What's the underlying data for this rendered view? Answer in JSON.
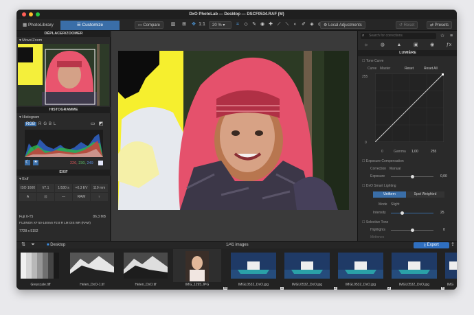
{
  "window": {
    "title": "DxO PhotoLab — Desktop — DSCF0534.RAF (M)"
  },
  "toolbar": {
    "tab_library": "PhotoLibrary",
    "tab_customize": "Customize",
    "compare": "Compare",
    "ratio": "1:1",
    "zoom": "20 %",
    "local_adjustments": "Local Adjustments",
    "reset": "Reset",
    "presets": "Presets"
  },
  "left": {
    "move_zoom_header": "DÉPLACER/ZOOMER",
    "move_zoom_sub": "Move/Zoom",
    "histogram_header": "HISTOGRAMME",
    "histogram_sub": "Histogram",
    "channels": [
      "RGB",
      "R",
      "G",
      "B",
      "L"
    ],
    "rgb_r": "226,",
    "rgb_g": "230,",
    "rgb_b": "249",
    "exif_header": "EXIF",
    "exif_sub": "Exif",
    "exif_row1": [
      "ISO 1600",
      "f/7.1",
      "1/180 s",
      "+0.3 EV",
      "119 mm"
    ],
    "exif_row2": [
      "A",
      "",
      "—",
      "RAW",
      ""
    ],
    "camera": "Fuji X-T5",
    "size": "86,3 MB",
    "lens": "FUJINON XF 50-140mm F2.8 R LM OIS WR (RAW)",
    "dims": "7728 x 5152"
  },
  "right": {
    "search_placeholder": "Search for corrections",
    "header": "LUMIÈRE",
    "tone_curve": "Tone Curve",
    "curve_label": "Curve",
    "curve_channel": "Master",
    "curve_reset": "Reset",
    "curve_reset_all": "Reset All",
    "curve_top_left": "255",
    "curve_bottom_left": "0",
    "curve_bottom_0": "0",
    "gamma_label": "Gamma",
    "gamma": "1,00",
    "curve_max": "255",
    "exposure_comp": "Exposure Compensation",
    "correction_label": "Correction",
    "correction_value": "Manual",
    "exposure_label": "Exposure",
    "exposure_value": "0,00",
    "smart_lighting": "DxO Smart Lighting",
    "mode_uniform": "Uniform",
    "mode_spot": "Spot Weighted",
    "mode_label": "Mode",
    "mode_value": "Slight",
    "intensity_label": "Intensity",
    "intensity_value": "25",
    "selective_tone": "Selective Tone",
    "highlights_label": "Highlights",
    "highlights_value": "0",
    "midtones_label": "Midtones"
  },
  "browser": {
    "folder": "Desktop",
    "count": "1/41 images",
    "export": "Export",
    "items": [
      {
        "name": "Greyscale.tiff",
        "badge": ""
      },
      {
        "name": "Helen_DxO-1.tif",
        "badge": ""
      },
      {
        "name": "Helen_DxO.tif",
        "badge": ""
      },
      {
        "name": "IMG_1295.JPG",
        "badge": "M"
      },
      {
        "name": "IMGL0532_DxO.jpg",
        "badge": "1"
      },
      {
        "name": "IMGL0532_DxO.jpg",
        "badge": "2"
      },
      {
        "name": "IMGL0532_DxO.jpg",
        "badge": "3"
      },
      {
        "name": "IMGL0532_DxO.jpg",
        "badge": "4"
      },
      {
        "name": "IMG",
        "badge": ""
      }
    ]
  },
  "colors": {
    "accent": "#3a6ea8",
    "export": "#2f6fc0"
  }
}
